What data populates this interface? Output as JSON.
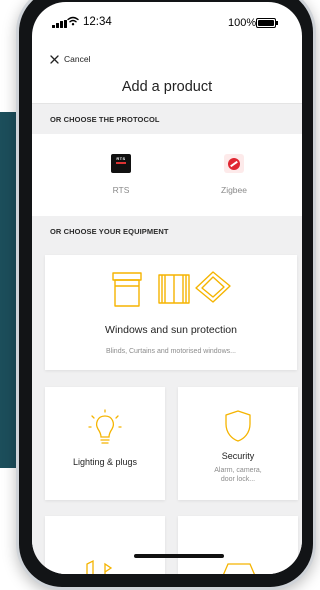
{
  "status_bar": {
    "time": "12:34",
    "battery": "100%"
  },
  "header": {
    "cancel_label": "Cancel",
    "title": "Add a product"
  },
  "sections": {
    "protocol_heading": "OR CHOOSE THE PROTOCOL",
    "equipment_heading": "OR CHOOSE YOUR EQUIPMENT"
  },
  "protocols": [
    {
      "label": "RTS",
      "icon": "rts-logo-icon",
      "logo_text": "RTS"
    },
    {
      "label": "Zigbee",
      "icon": "zigbee-logo-icon"
    }
  ],
  "equipment": [
    {
      "title": "Windows and sun protection",
      "subtitle": "Blinds, Curtains and motorised windows...",
      "icon": "window-blind-icon"
    },
    {
      "title": "Lighting & plugs",
      "icon": "lightbulb-icon"
    },
    {
      "title": "Security",
      "subtitle": "Alarm, camera, door lock...",
      "icon": "shield-icon"
    }
  ],
  "colors": {
    "accent": "#f5b400",
    "teal": "#1c4e5b",
    "zigbee": "#e02732",
    "section_bg": "#f0f0f1"
  }
}
